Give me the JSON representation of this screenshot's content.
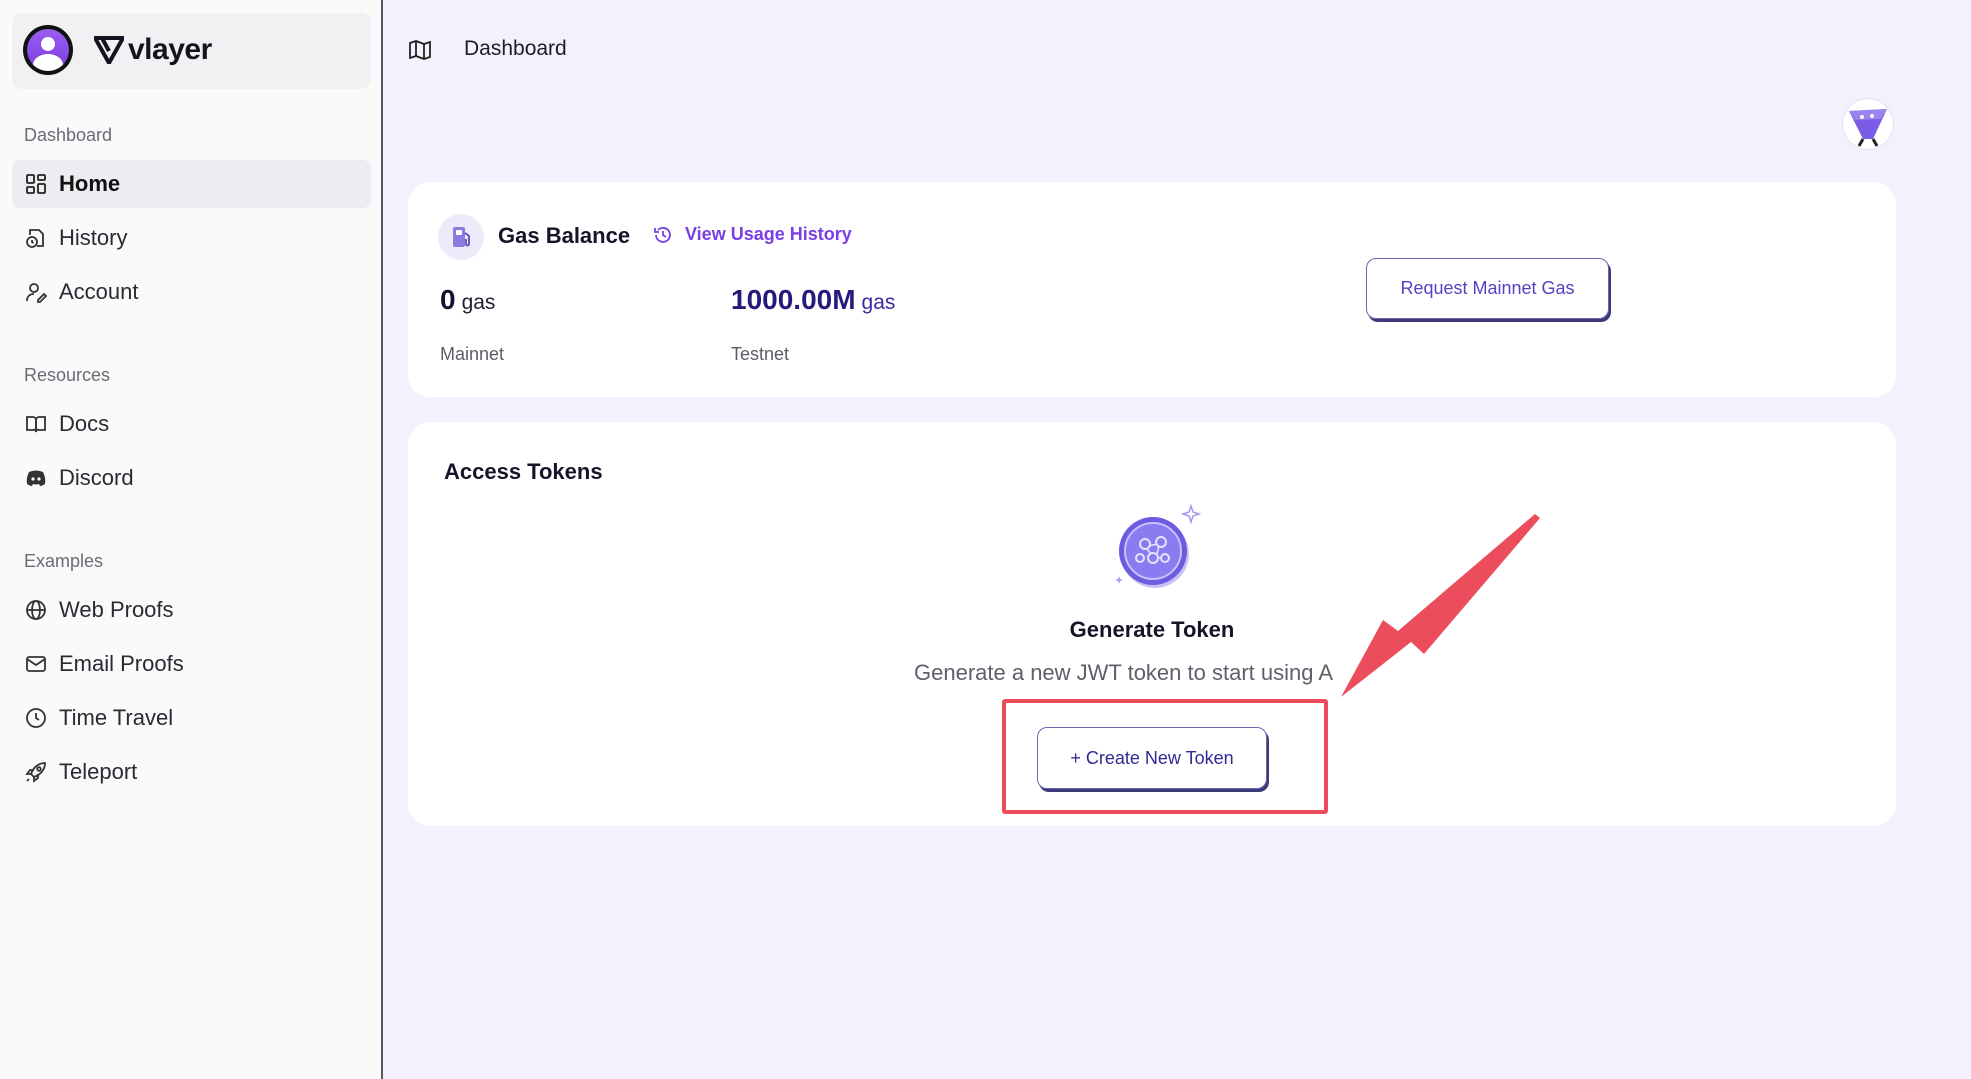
{
  "brand": {
    "name": "vlayer"
  },
  "sidebar": {
    "sections": [
      {
        "title": "Dashboard"
      },
      {
        "title": "Resources"
      },
      {
        "title": "Examples"
      }
    ],
    "items": [
      {
        "label": "Home",
        "icon": "grid-icon"
      },
      {
        "label": "History",
        "icon": "history-file-icon"
      },
      {
        "label": "Account",
        "icon": "user-edit-icon"
      },
      {
        "label": "Docs",
        "icon": "book-icon"
      },
      {
        "label": "Discord",
        "icon": "discord-icon"
      },
      {
        "label": "Web Proofs",
        "icon": "globe-icon"
      },
      {
        "label": "Email Proofs",
        "icon": "mail-icon"
      },
      {
        "label": "Time Travel",
        "icon": "clock-icon"
      },
      {
        "label": "Teleport",
        "icon": "rocket-icon"
      }
    ]
  },
  "header": {
    "title": "Dashboard",
    "icon": "map-icon"
  },
  "gas": {
    "title": "Gas Balance",
    "history_link": "View Usage History",
    "mainnet_value": "0",
    "mainnet_unit": "gas",
    "mainnet_label": "Mainnet",
    "testnet_value": "1000.00M",
    "testnet_unit": "gas",
    "testnet_label": "Testnet",
    "request_button": "Request Mainnet Gas"
  },
  "tokens": {
    "title": "Access Tokens",
    "empty_title": "Generate Token",
    "empty_desc": "Generate a new JWT token to start using A",
    "create_button": "+ Create New Token"
  },
  "colors": {
    "accent": "#7a3fe6",
    "page_bg": "#f3f2fc",
    "annotation": "#ec4d5c"
  }
}
